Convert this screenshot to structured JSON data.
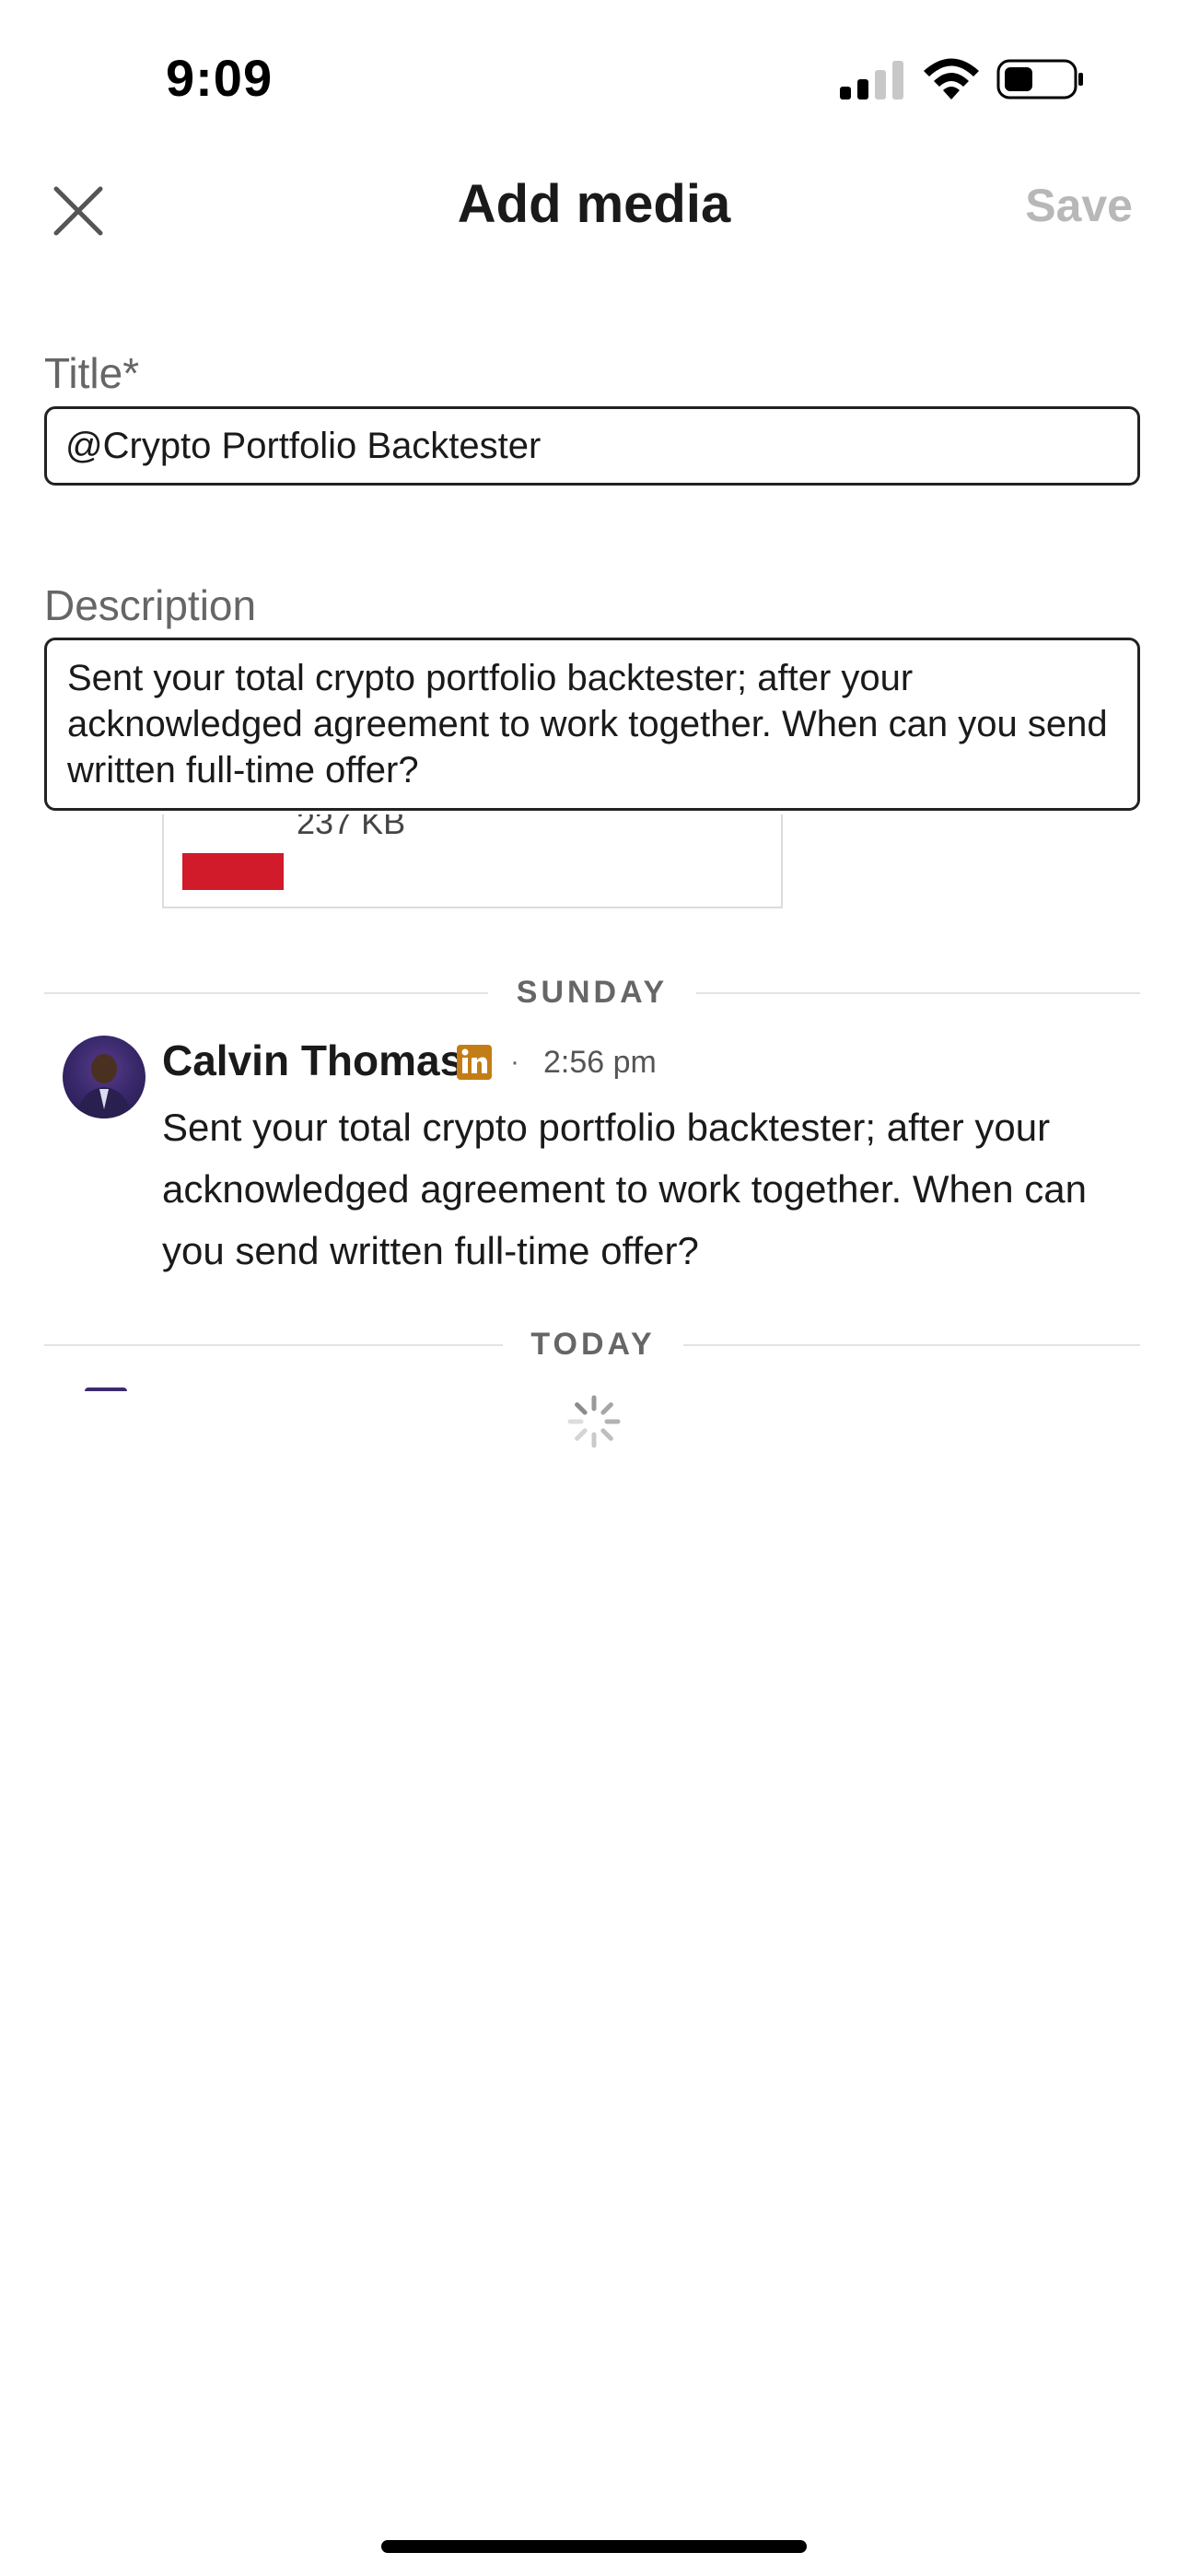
{
  "status_bar": {
    "time": "9:09"
  },
  "header": {
    "title": "Add media",
    "save_label": "Save"
  },
  "form": {
    "title_label": "Title*",
    "title_value": "@Crypto Portfolio Backtester",
    "description_label": "Description",
    "description_value": "Sent your total crypto portfolio backtester; after your acknowledged agreement to work together. When can you send written full-time offer?"
  },
  "attachment": {
    "size_text": "237 KB"
  },
  "conversation": {
    "day_labels": [
      "SUNDAY",
      "TODAY"
    ],
    "messages": [
      {
        "sender": "Calvin Thomas",
        "separator": "·",
        "time": "2:56 pm",
        "text": "Sent your total crypto portfolio backtester; after your acknowledged agreement to work together. When can you send written full-time offer?"
      }
    ]
  },
  "colors": {
    "save_disabled": "#b8b8b8",
    "linkedin_badge": "#c37d16",
    "attachment_thumb": "#d11a2a"
  },
  "icons": {
    "close": "close-icon",
    "badge": "linkedin-icon",
    "spinner": "loading-spinner-icon"
  }
}
